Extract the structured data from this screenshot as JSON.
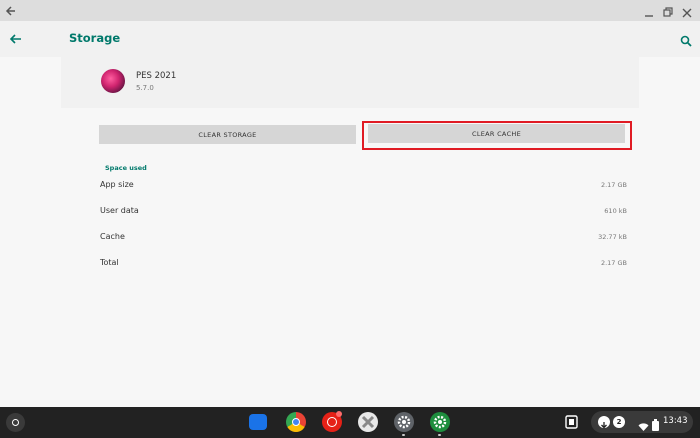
{
  "appbar": {
    "title": "Storage"
  },
  "app": {
    "name": "PES 2021",
    "version": "5.7.0"
  },
  "buttons": {
    "clear_storage": "CLEAR STORAGE",
    "clear_cache": "CLEAR CACHE"
  },
  "section": {
    "label": "Space used"
  },
  "rows": [
    {
      "label": "App size",
      "value": "2.17 GB"
    },
    {
      "label": "User data",
      "value": "610 kB"
    },
    {
      "label": "Cache",
      "value": "32.77 kB"
    },
    {
      "label": "Total",
      "value": "2.17 GB"
    }
  ],
  "shelf": {
    "clock": "13:43",
    "notification_count": "2",
    "apps": [
      "files-icon",
      "chrome-icon",
      "youtube-music-icon",
      "game-app-icon",
      "settings-icon",
      "android-settings-icon"
    ]
  },
  "colors": {
    "accent": "#00796b",
    "highlight": "#e01b24"
  }
}
